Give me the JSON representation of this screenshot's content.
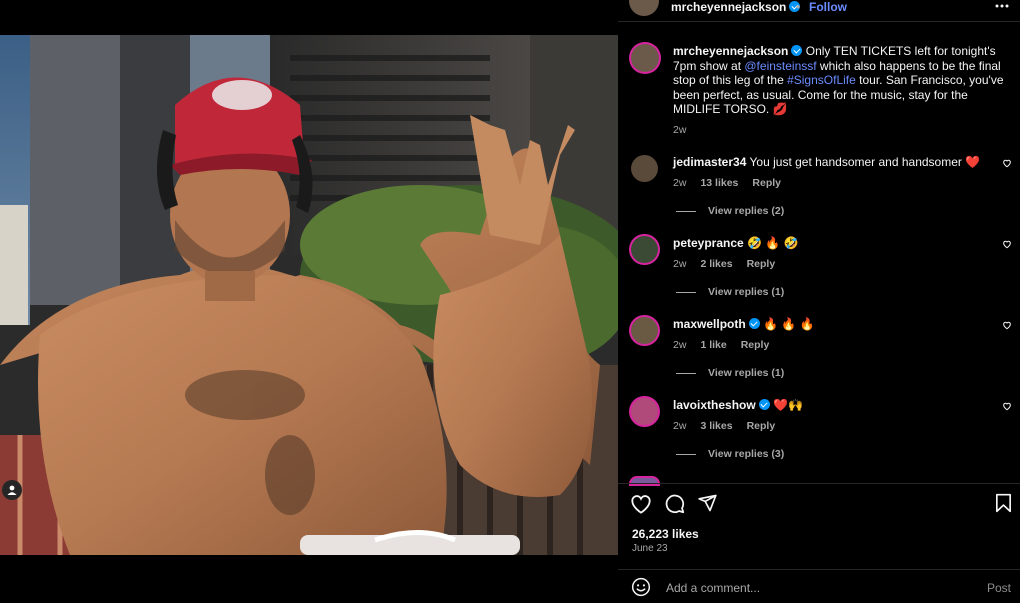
{
  "post": {
    "username": "mrcheyennejackson",
    "follow_label": "Follow",
    "more_icon": "more-horizontal-icon"
  },
  "caption": {
    "username": "mrcheyennejackson",
    "text_1": "Only TEN TICKETS left for tonight's 7pm show at ",
    "mention": "@feinsteinssf",
    "text_2": " which also happens to be the final stop of this leg of the ",
    "hashtag": "#SignsOfLife",
    "text_3": " tour. San Francisco, you've been perfect, as usual. Come for the music, stay for the MIDLIFE TORSO. 💋",
    "time": "2w"
  },
  "comments": [
    {
      "username": "jedimaster34",
      "text": "You just get handsomer and handsomer ❤️",
      "time": "2w",
      "likes": "13 likes",
      "reply": "Reply",
      "replies": "View replies (2)",
      "verified": false,
      "avatar_color": "#5a4a3a"
    },
    {
      "username": "peteyprance",
      "text": "🤣 🔥 🤣",
      "time": "2w",
      "likes": "2 likes",
      "reply": "Reply",
      "replies": "View replies (1)",
      "verified": false,
      "avatar_color": "#3b4a34"
    },
    {
      "username": "maxwellpoth",
      "text": "🔥 🔥 🔥",
      "time": "2w",
      "likes": "1 like",
      "reply": "Reply",
      "replies": "View replies (1)",
      "verified": true,
      "avatar_color": "#6a5a44"
    },
    {
      "username": "lavoixtheshow",
      "text": "❤️🙌",
      "time": "2w",
      "likes": "3 likes",
      "reply": "Reply",
      "replies": "View replies (3)",
      "verified": true,
      "avatar_color": "#b04a7a"
    }
  ],
  "footer": {
    "likes": "26,223 likes",
    "date": "June 23",
    "comment_placeholder": "Add a comment...",
    "post_label": "Post"
  },
  "colors": {
    "background": "#000000",
    "link": "#6b8cff",
    "verified": "#0095f6",
    "muted": "#a8a8a8"
  }
}
